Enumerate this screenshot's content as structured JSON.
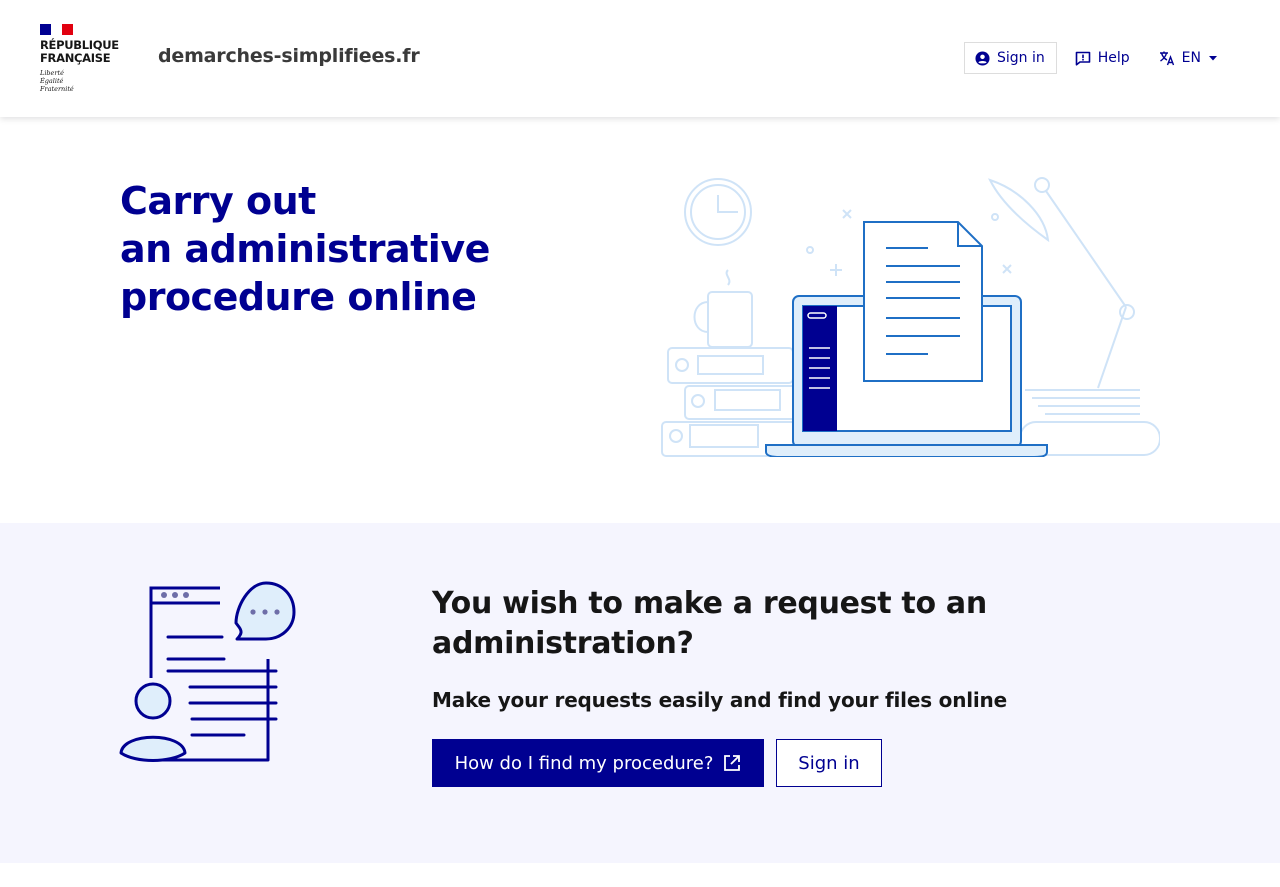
{
  "header": {
    "logo": {
      "line1": "RÉPUBLIQUE",
      "line2": "FRANÇAISE",
      "motto1": "Liberté",
      "motto2": "Égalité",
      "motto3": "Fraternité"
    },
    "site_name": "demarches-simplifiees.fr",
    "tools": {
      "sign_in": {
        "label": "Sign in",
        "icon": "account-circle-icon"
      },
      "help": {
        "label": "Help",
        "icon": "question-chat-icon"
      },
      "language": {
        "label": "EN",
        "icon": "translate-icon"
      }
    }
  },
  "hero": {
    "title_line1": "Carry out",
    "title_line2": "an administrative",
    "title_line3": "procedure online"
  },
  "request": {
    "title": "You wish to make a request to an administration?",
    "subtitle": "Make your requests easily and find your files online",
    "primary_button": "How do I find my procedure?",
    "secondary_button": "Sign in"
  },
  "colors": {
    "brand_blue": "#000091",
    "flag_blue": "#000091",
    "flag_red": "#e1000f",
    "section_bg": "#f5f5fe",
    "illustration_light": "#cfe3f7",
    "illustration_mid": "#1f6fc5"
  }
}
